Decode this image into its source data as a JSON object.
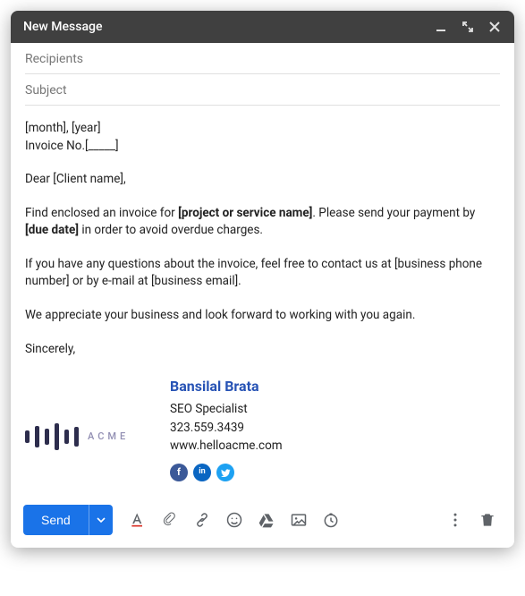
{
  "window": {
    "title": "New Message"
  },
  "fields": {
    "recipients_placeholder": "Recipients",
    "subject_placeholder": "Subject"
  },
  "body": {
    "line1": "[month], [year]",
    "line2": "Invoice No.[_____]",
    "greeting": "Dear [Client name],",
    "p1_a": "Find enclosed an invoice for ",
    "p1_b": "[project or service name]",
    "p1_c": ". Please send your payment by ",
    "p1_d": "[due date]",
    "p1_e": " in order to avoid overdue charges.",
    "p2": "If you have any questions about the invoice, feel free to contact us at [business phone number] or by e-mail at [business email].",
    "p3": "We appreciate your business and look forward to working with you again.",
    "closing": "Sincerely,"
  },
  "signature": {
    "logo_text": "ACME",
    "name": "Bansilal Brata",
    "title": "SEO Specialist",
    "phone": "323.559.3439",
    "website": "www.helloacme.com",
    "socials": {
      "facebook": {
        "glyph": "f",
        "bg": "#3b5998"
      },
      "linkedin": {
        "glyph": "in",
        "bg": "#0a66c2"
      },
      "twitter": {
        "bg": "#1da1f2"
      }
    }
  },
  "toolbar": {
    "send_label": "Send"
  },
  "colors": {
    "primary": "#1a73e8"
  }
}
